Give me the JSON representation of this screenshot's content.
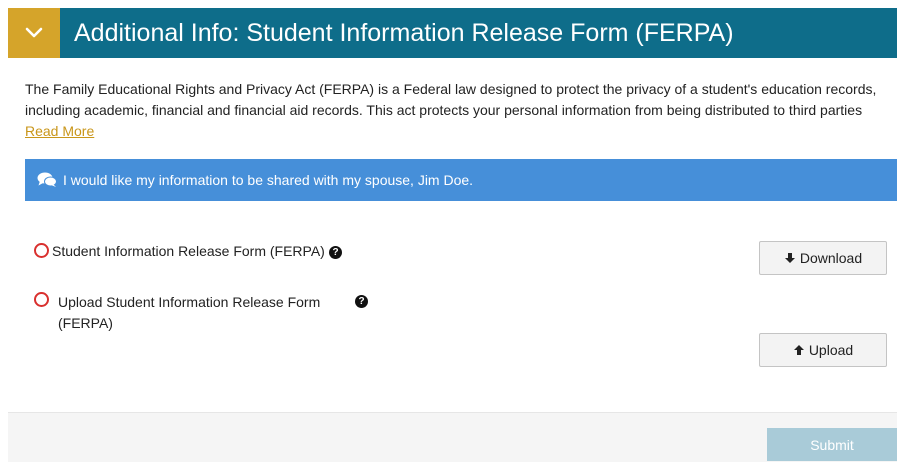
{
  "header": {
    "title": "Additional Info: Student Information Release Form (FERPA)",
    "toggle_icon": "chevron-down-icon",
    "accent": "#d5a42a",
    "background": "#0e6d8a"
  },
  "intro": {
    "text": "The Family Educational Rights and Privacy Act (FERPA) is a Federal law designed to protect the privacy of a student's education records, including academic, financial and financial aid records. This act protects your personal information from being distributed to third parties",
    "read_more": "Read More"
  },
  "alert": {
    "icon": "comments-icon",
    "message": "I would like my information to be shared with my spouse, Jim Doe.",
    "color": "#468fd9"
  },
  "items": [
    {
      "label": "Student Information Release Form (FERPA)",
      "button_label": "Download",
      "button_icon": "arrow-down-icon"
    },
    {
      "label_line1": "Upload Student Information Release Form",
      "label_line2": "(FERPA)",
      "button_label": "Upload",
      "button_icon": "arrow-up-icon"
    }
  ],
  "footer": {
    "submit_label": "Submit"
  }
}
